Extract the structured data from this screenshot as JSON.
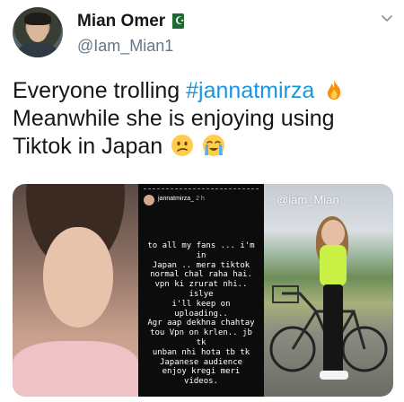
{
  "author": {
    "display_name": "Mian Omer",
    "handle": "@Iam_Mian1",
    "flag_icon": "pakistan-flag-icon"
  },
  "tweet": {
    "text_part1": "Everyone trolling ",
    "hashtag": "#jannatmirza",
    "text_part2": "Meanwhile she is enjoying using Tiktok in Japan",
    "emojis": [
      "fire-emoji",
      "confused-face-emoji",
      "loudly-crying-face-emoji"
    ]
  },
  "media": {
    "story": {
      "username": "jannatmirza_",
      "time": "2 h",
      "text": "to all my fans ... i'm in\nJapan .. mera tiktok\nnormal chal raha hai.\nvpn ki zrurat nhi.. islye\ni'll keep on uploading..\nAgr aap dekhna chahtay\ntou Vpn on krlen.. jb tk\nunban nhi hota tb tk\nJapanese audience\nenjoy kregi meri videos."
    },
    "watermark": "@iam_Mian"
  },
  "colors": {
    "hashtag": "#1b95e0",
    "handle": "#657786",
    "text": "#14171a"
  }
}
